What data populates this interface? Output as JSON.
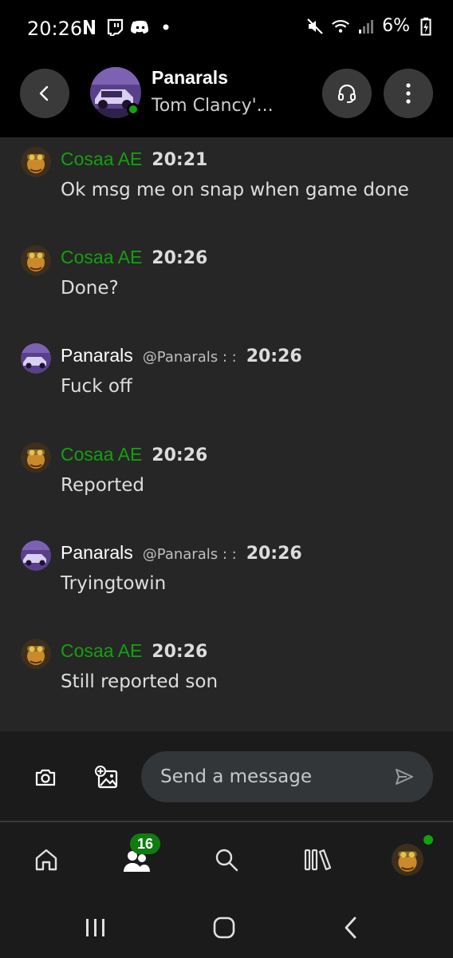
{
  "status_bar": {
    "time": "20:26",
    "battery": "6%",
    "left_icons": [
      "netflix-icon",
      "twitch-icon",
      "discord-icon",
      "dot-icon"
    ],
    "right_icons": [
      "mute-icon",
      "wifi-icon",
      "signal-icon",
      "battery-icon"
    ]
  },
  "header": {
    "name": "Panarals",
    "status": "Tom Clancy'...",
    "online": true
  },
  "messages": [
    {
      "sender": "Cosaa AE",
      "handle": "",
      "time": "20:21",
      "text": "Ok msg me on snap when game done",
      "sender_color": "#13a10e",
      "avatar": "cosaa"
    },
    {
      "sender": "Cosaa AE",
      "handle": "",
      "time": "20:26",
      "text": "Done?",
      "sender_color": "#13a10e",
      "avatar": "cosaa"
    },
    {
      "sender": "Panarals",
      "handle": "@Panarals : :",
      "time": "20:26",
      "text": "Fuck off",
      "sender_color": "#ffffff",
      "avatar": "panarals"
    },
    {
      "sender": "Cosaa AE",
      "handle": "",
      "time": "20:26",
      "text": "Reported",
      "sender_color": "#13a10e",
      "avatar": "cosaa"
    },
    {
      "sender": "Panarals",
      "handle": "@Panarals : :",
      "time": "20:26",
      "text": "Tryingtowin",
      "sender_color": "#ffffff",
      "avatar": "panarals"
    },
    {
      "sender": "Cosaa AE",
      "handle": "",
      "time": "20:26",
      "text": "Still reported son",
      "sender_color": "#13a10e",
      "avatar": "cosaa"
    }
  ],
  "composer": {
    "placeholder": "Send a message"
  },
  "bottom_nav": {
    "social_badge": "16"
  },
  "colors": {
    "accent": "#13a10e",
    "chat_bg": "#262626",
    "bar_bg": "#1b1b1b"
  }
}
